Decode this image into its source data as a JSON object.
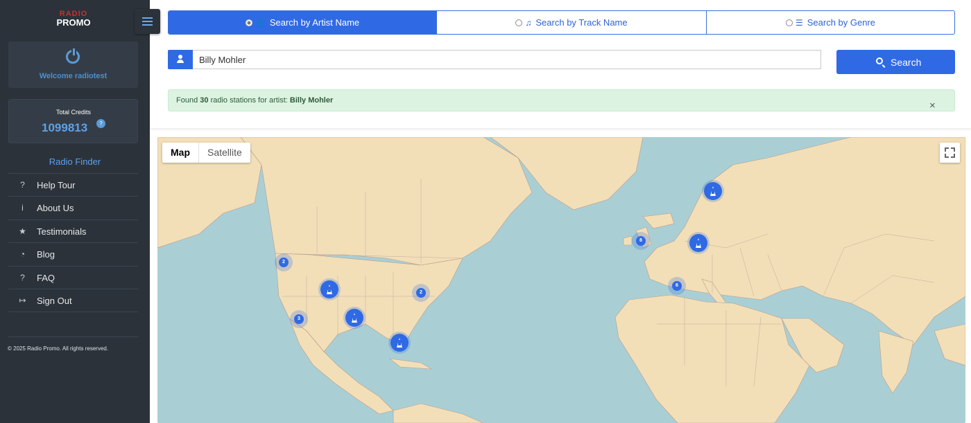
{
  "sidebar": {
    "logo_top": "RADIO",
    "logo_bottom": "PROMO",
    "welcome": "Welcome radiotest",
    "credits_label": "Total Credits",
    "credits_value": "1099813",
    "help_badge": "?",
    "radio_finder": "Radio Finder",
    "nav": [
      {
        "label": "Help Tour",
        "icon": "question-circle-icon",
        "glyph": "?"
      },
      {
        "label": "About Us",
        "icon": "info-circle-icon",
        "glyph": "i"
      },
      {
        "label": "Testimonials",
        "icon": "star-icon",
        "glyph": "★"
      },
      {
        "label": "Blog",
        "icon": "rss-icon",
        "glyph": "◔"
      },
      {
        "label": "FAQ",
        "icon": "question-icon",
        "glyph": "?"
      },
      {
        "label": "Sign Out",
        "icon": "sign-out-icon",
        "glyph": "↦"
      }
    ],
    "copyright": "© 2025 Radio Promo. All rights reserved."
  },
  "search_modes": [
    {
      "label": "Search by Artist Name",
      "icon": "user-icon",
      "glyph": "👤",
      "active": true
    },
    {
      "label": "Search by Track Name",
      "icon": "music-icon",
      "glyph": "♫",
      "active": false
    },
    {
      "label": "Search by Genre",
      "icon": "list-icon",
      "glyph": "☰",
      "active": false
    }
  ],
  "search": {
    "value": "Billy Mohler",
    "button_label": "Search"
  },
  "alert": {
    "prefix": "Found",
    "count": "30",
    "middle": "radio stations for artist:",
    "artist": "Billy Mohler",
    "close": "×"
  },
  "map": {
    "type_options": [
      "Map",
      "Satellite"
    ],
    "selected_type": "Map",
    "clusters": [
      "2",
      "2",
      "3",
      "8",
      "6"
    ],
    "accent": "#2f6ae4",
    "water": "#a9cfd5",
    "land": "#f2dfb8"
  }
}
